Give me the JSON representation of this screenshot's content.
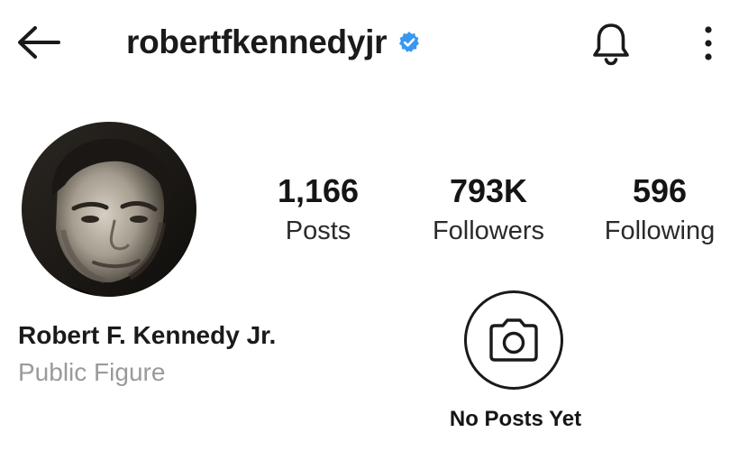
{
  "header": {
    "username": "robertfkennedyjr",
    "verified": true,
    "icons": {
      "back": "arrow-left-icon",
      "verified": "verified-badge-icon",
      "notifications": "bell-icon",
      "more": "more-vertical-icon"
    }
  },
  "profile": {
    "avatar": "profile-photo",
    "full_name": "Robert F. Kennedy Jr.",
    "category": "Public Figure"
  },
  "stats": {
    "posts": {
      "value": "1,166",
      "label": "Posts"
    },
    "followers": {
      "value": "793K",
      "label": "Followers"
    },
    "following": {
      "value": "596",
      "label": "Following"
    }
  },
  "empty_state": {
    "icon": "camera-icon",
    "title": "No Posts Yet"
  },
  "colors": {
    "verified_blue": "#3897f0",
    "text_primary": "#1a1a1a",
    "text_secondary": "#9a9a9a",
    "background": "#ffffff"
  }
}
